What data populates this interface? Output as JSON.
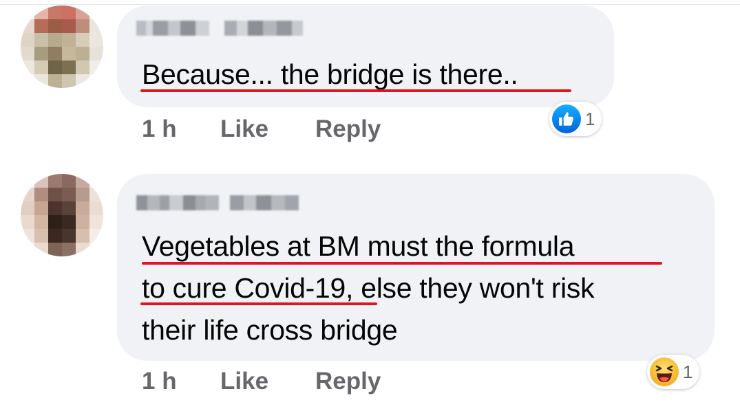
{
  "comments": [
    {
      "author": "",
      "text_lines": [
        "Because... the bridge is there.."
      ],
      "time": "1 h",
      "like_label": "Like",
      "reply_label": "Reply",
      "reaction": {
        "icon": "thumbs-up-icon",
        "count": "1"
      }
    },
    {
      "author": "",
      "text_lines": [
        "Vegetables at BM must the formula",
        "to cure Covid-19, else they won't risk",
        "their life cross bridge"
      ],
      "time": "1 h",
      "like_label": "Like",
      "reply_label": "Reply",
      "reaction": {
        "icon": "laughing-face-icon",
        "count": "1"
      }
    }
  ],
  "colors": {
    "bubble": "#f0f2f5",
    "underline": "#e0141e",
    "action_text": "#65676b",
    "like_blue": "#1877f2",
    "haha_yellow": "#f7b125"
  }
}
